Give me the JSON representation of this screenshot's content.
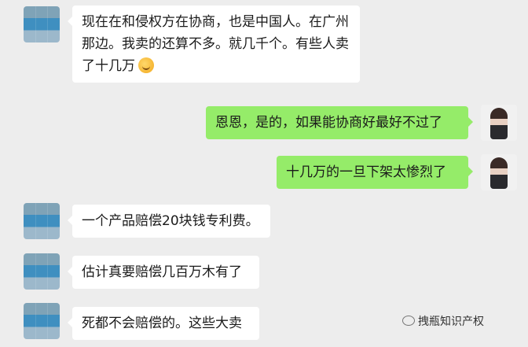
{
  "messages": [
    {
      "id": "m1",
      "side": "in",
      "text": "现在在和侵权方在协商，也是中国人。在广州那边。我卖的还算不多。就几千个。有些人卖了十几万",
      "emoji": "facepalm-emoji"
    },
    {
      "id": "m2",
      "side": "out",
      "text": "恩恩，是的，如果能协商好最好不过了"
    },
    {
      "id": "m3",
      "side": "out",
      "text": "十几万的一旦下架太惨烈了"
    },
    {
      "id": "m4",
      "side": "in",
      "text": "一个产品赔偿20块钱专利费。"
    },
    {
      "id": "m5",
      "side": "in",
      "text": "估计真要赔偿几百万木有了"
    },
    {
      "id": "m6",
      "side": "in",
      "text": "死都不会赔偿的。这些大卖"
    }
  ],
  "watermark": {
    "icon": "wechat-official-icon",
    "text": "拽瓶知识产权"
  },
  "colors": {
    "background": "#ededed",
    "incoming_bubble": "#ffffff",
    "outgoing_bubble": "#95ec69",
    "text": "#1a1a1a"
  }
}
